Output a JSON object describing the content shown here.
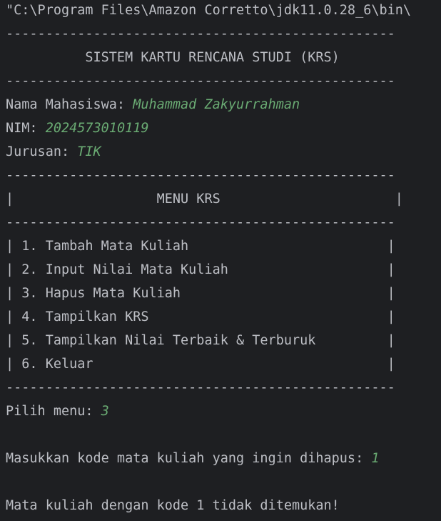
{
  "console": {
    "command_line": "\"C:\\Program Files\\Amazon Corretto\\jdk11.0.28_6\\bin\\",
    "separator": "-------------------------------------------------",
    "title": "          SISTEM KARTU RENCANA STUDI (KRS)",
    "nama_label": "Nama Mahasiswa: ",
    "nama_value": "Muhammad Zakyurrahman",
    "nim_label": "NIM: ",
    "nim_value": "2024573010119",
    "jurusan_label": "Jurusan: ",
    "jurusan_value": "TIK",
    "menu_header": "|                  MENU KRS                      |",
    "menu_items": [
      "| 1. Tambah Mata Kuliah                         |",
      "| 2. Input Nilai Mata Kuliah                    |",
      "| 3. Hapus Mata Kuliah                          |",
      "| 4. Tampilkan KRS                              |",
      "| 5. Tampilkan Nilai Terbaik & Terburuk         |",
      "| 6. Keluar                                     |"
    ],
    "pilih_label": "Pilih menu: ",
    "pilih_value": "3",
    "hapus_prompt": "Masukkan kode mata kuliah yang ingin dihapus: ",
    "hapus_value": "1",
    "result_message": "Mata kuliah dengan kode 1 tidak ditemukan!"
  },
  "colors": {
    "background": "#1e1f22",
    "text": "#bcbec4",
    "user_input": "#6aab73"
  }
}
